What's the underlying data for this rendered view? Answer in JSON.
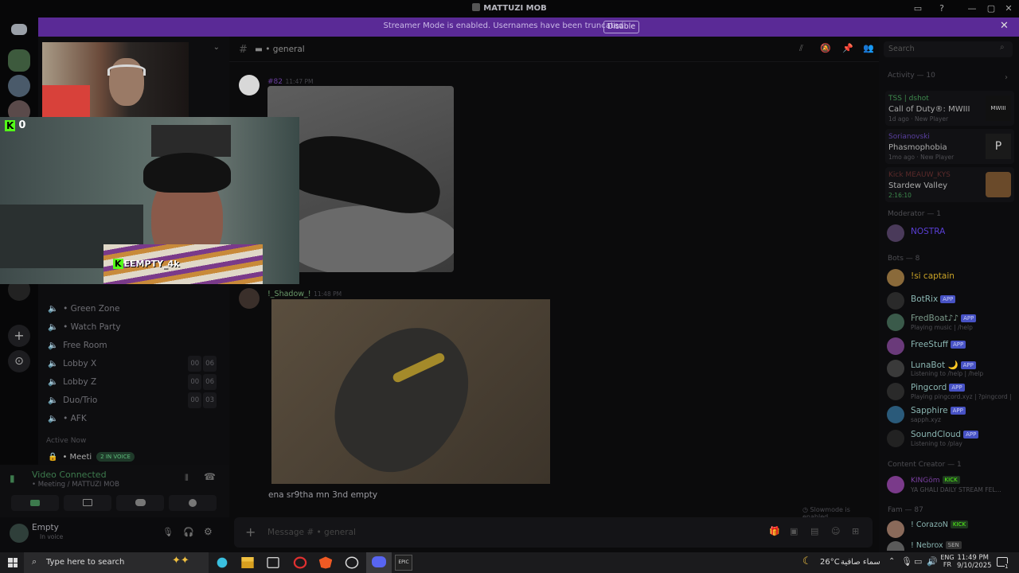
{
  "window": {
    "title": "MATTUZI MOB"
  },
  "banner": {
    "message": "Streamer Mode is enabled. Usernames have been truncated.",
    "button": "Disable"
  },
  "chat_header": {
    "channel": "• general",
    "search_placeholder": "Search"
  },
  "messages": [
    {
      "author": "#82",
      "time": "11:47 PM"
    },
    {
      "author": "!_Shadow_!",
      "time": "11:48 PM",
      "text": "ena sr9tha mn 3nd empty"
    }
  ],
  "slowmode": "Slowmode is enabled.",
  "composer": {
    "placeholder": "Message # • general"
  },
  "channels": [
    {
      "name": "• Green Zone"
    },
    {
      "name": "• Watch Party"
    },
    {
      "name": "Free Room"
    },
    {
      "name": "Lobby X",
      "count": [
        "00",
        "06"
      ]
    },
    {
      "name": "Lobby Z",
      "count": [
        "00",
        "06"
      ]
    },
    {
      "name": "Duo/Trio",
      "count": [
        "00",
        "03"
      ]
    },
    {
      "name": "• AFK"
    }
  ],
  "active_now": {
    "label": "Active Now",
    "channel": "• Meeti",
    "voice_badge": "2 IN VOICE"
  },
  "voice": {
    "status": "Video Connected",
    "location": "• Meeting / MATTUZI MOB"
  },
  "user": {
    "name": "Empty",
    "status": "In voice"
  },
  "stream": {
    "kick_count": "0",
    "streamer": "EEMPTY_4k"
  },
  "activity": {
    "title": "Activity — 10",
    "items": [
      {
        "user": "TSS | dshot",
        "game": "Call of Duty®: MWIII",
        "meta": "1d ago",
        "meta2": "New Player",
        "thumb": "MWIII"
      },
      {
        "user": "Sorianovski",
        "game": "Phasmophobia",
        "meta": "1mo ago",
        "meta2": "New Player",
        "thumb": "P"
      },
      {
        "user": "Kick MEAUW_KYS",
        "game": "Stardew Valley",
        "meta": "2:16:10"
      }
    ]
  },
  "member_groups": [
    {
      "title": "Moderator — 1",
      "members": [
        {
          "name": "NOSTRA",
          "color": "#5a3fd6"
        }
      ]
    },
    {
      "title": "Bots — 8",
      "members": [
        {
          "name": "!si captain",
          "color": "#c9a227"
        },
        {
          "name": "BotRix",
          "tag": "APP",
          "color": "#8ab5b1"
        },
        {
          "name": "FredBoat♪♪",
          "tag": "APP",
          "sub": "Playing music | /help",
          "color": "#7c9b8b"
        },
        {
          "name": "FreeStuff",
          "tag": "APP",
          "color": "#8ab5b1"
        },
        {
          "name": "LunaBot 🌙",
          "tag": "APP",
          "sub": "Listening to /help | /help",
          "color": "#8ab5b1"
        },
        {
          "name": "Pingcord",
          "tag": "APP",
          "sub": "Playing pingcord.xyz | ?pingcord |",
          "color": "#8ab5b1"
        },
        {
          "name": "Sapphire",
          "tag": "APP",
          "sub": "sapph.xyz",
          "color": "#8ab5b1"
        },
        {
          "name": "SoundCloud",
          "tag": "APP",
          "sub": "Listening to /play",
          "color": "#8ab5b1"
        }
      ]
    },
    {
      "title": "Content Creator — 1",
      "members": [
        {
          "name": "KINGöm",
          "tag": "KICK",
          "sub": "YA GHALI DAILY STREAM FEL...",
          "color": "#7a3fa0"
        }
      ]
    },
    {
      "title": "Fam — 87",
      "members": [
        {
          "name": "! CorazoN",
          "tag": "KICK",
          "color": "#8ab5b1"
        },
        {
          "name": "! Nebrox",
          "tag": "SEN",
          "color": "#8ab5b1"
        }
      ]
    }
  ],
  "taskbar": {
    "search_placeholder": "Type here to search",
    "weather": "26°C",
    "weather_desc": "سماء صافية",
    "lang1": "ENG",
    "lang2": "FR",
    "time": "11:49 PM",
    "date": "9/10/2025",
    "notif_count": "1"
  },
  "colors": {
    "banner": "#5a2a96",
    "accent": "#5865f2",
    "online": "#23a55a",
    "kick": "#53fc18"
  }
}
